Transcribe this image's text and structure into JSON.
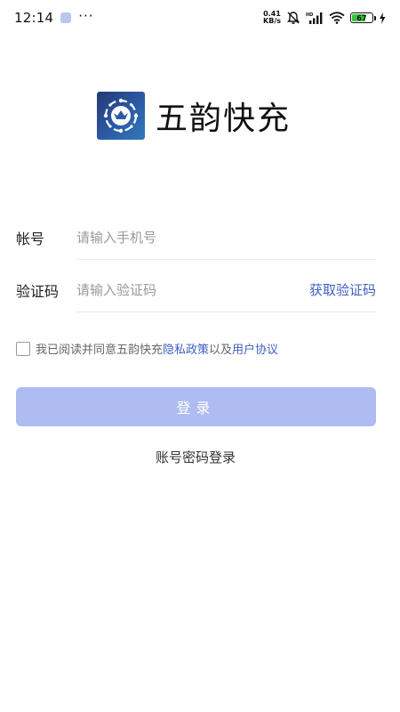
{
  "status_bar": {
    "time": "12:14",
    "dots": "···",
    "net_speed_value": "0.41",
    "net_speed_unit": "KB/s",
    "network_badge": "HD",
    "battery_level": "67",
    "icons": [
      "app-notification-icon",
      "mute-bell-icon",
      "signal-icon",
      "wifi-icon",
      "battery-icon",
      "charging-bolt-icon"
    ]
  },
  "app": {
    "name": "五韵快充",
    "brand_color": "#2c5aa6"
  },
  "form": {
    "phone_label": "帐号",
    "phone_placeholder": "请输入手机号",
    "code_label": "验证码",
    "code_placeholder": "请输入验证码",
    "get_code_label": "获取验证码"
  },
  "agreement": {
    "checked": false,
    "prefix_text": "我已阅读并同意五韵快充",
    "privacy_link": "隐私政策",
    "joiner": "以及",
    "user_link": "用户协议"
  },
  "actions": {
    "login_label": "登录",
    "password_login_label": "账号密码登录"
  },
  "colors": {
    "accent": "#3f5fbf",
    "login_button_disabled": "#aebcf2",
    "battery_fill": "#35c43a"
  }
}
